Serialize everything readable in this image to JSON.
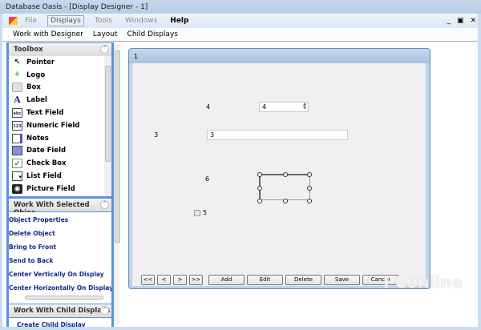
{
  "window": {
    "title": "Database Oasis - [Display Designer - 1]"
  },
  "menu": [
    "File",
    "Displays",
    "Tools",
    "Windows",
    "Help"
  ],
  "mdi_controls": [
    "_",
    "▣",
    "✕"
  ],
  "submenu": [
    "Work with Designer",
    "Layout",
    "Child Displays"
  ],
  "toolbox": {
    "title": "Toolbox",
    "items": [
      {
        "label": "Pointer",
        "icon": "pointer-icon"
      },
      {
        "label": "Logo",
        "icon": "logo-icon"
      },
      {
        "label": "Box",
        "icon": "box-icon"
      },
      {
        "label": "Label",
        "icon": "label-icon"
      },
      {
        "label": "Text Field",
        "icon": "text-field-icon"
      },
      {
        "label": "Numeric Field",
        "icon": "numeric-field-icon"
      },
      {
        "label": "Notes",
        "icon": "notes-icon"
      },
      {
        "label": "Date Field",
        "icon": "date-field-icon"
      },
      {
        "label": "Check Box",
        "icon": "check-box-icon"
      },
      {
        "label": "List Field",
        "icon": "list-field-icon"
      },
      {
        "label": "Picture Field",
        "icon": "picture-field-icon"
      }
    ]
  },
  "selected_panel": {
    "title": "Work With Selected Objec",
    "items": [
      "Object Properties",
      "Delete Object",
      "Bring to Front",
      "Send to Back",
      "Center Vertically On Display",
      "Center Horizontally On Display"
    ]
  },
  "child_panel": {
    "title": "Work With Child Displays",
    "items": [
      "Create Child Display"
    ]
  },
  "designer": {
    "title": "1",
    "numeric_label": "4",
    "numeric_value": "4",
    "text_label": "3",
    "text_value": "3",
    "box_label": "6",
    "checkbox_label": "5"
  },
  "nav_buttons": [
    "<<",
    "<",
    ">",
    ">>"
  ],
  "action_buttons": [
    "Add",
    "Edit",
    "Delete",
    "Save",
    "Cancel"
  ],
  "watermark": "PConline"
}
